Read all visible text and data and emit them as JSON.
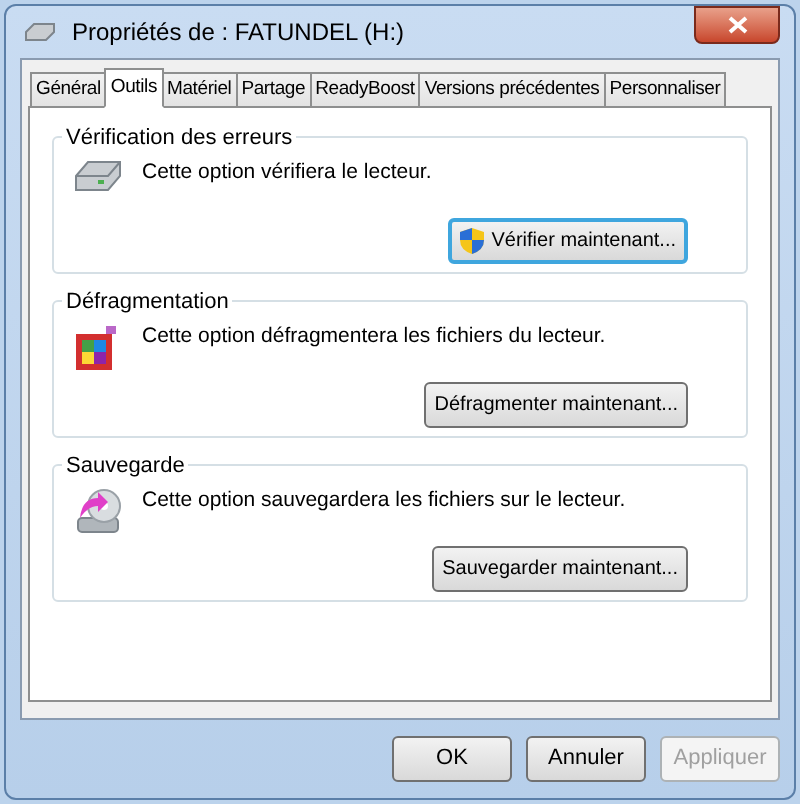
{
  "window": {
    "title": "Propriétés de : FATUNDEL (H:)"
  },
  "tabs": [
    {
      "label": "Général",
      "selected": false
    },
    {
      "label": "Outils",
      "selected": true
    },
    {
      "label": "Matériel",
      "selected": false
    },
    {
      "label": "Partage",
      "selected": false
    },
    {
      "label": "ReadyBoost",
      "selected": false
    },
    {
      "label": "Versions précédentes",
      "selected": false
    },
    {
      "label": "Personnaliser",
      "selected": false
    }
  ],
  "sections": [
    {
      "title": "Vérification des erreurs",
      "kind": "drive",
      "text": "Cette option vérifiera le lecteur.",
      "button": {
        "label": "Vérifier maintenant...",
        "elevated": true,
        "focused": true
      }
    },
    {
      "title": "Défragmentation",
      "kind": "defrag",
      "text": "Cette option défragmentera les fichiers du lecteur.",
      "button": {
        "label": "Défragmenter maintenant...",
        "elevated": false,
        "focused": false
      }
    },
    {
      "title": "Sauvegarde",
      "kind": "backup",
      "text": "Cette option sauvegardera les fichiers sur le lecteur.",
      "button": {
        "label": "Sauvegarder maintenant...",
        "elevated": false,
        "focused": false
      }
    }
  ],
  "buttons": [
    {
      "label": "OK",
      "disabled": false
    },
    {
      "label": "Annuler",
      "disabled": false
    },
    {
      "label": "Appliquer",
      "disabled": true
    }
  ]
}
